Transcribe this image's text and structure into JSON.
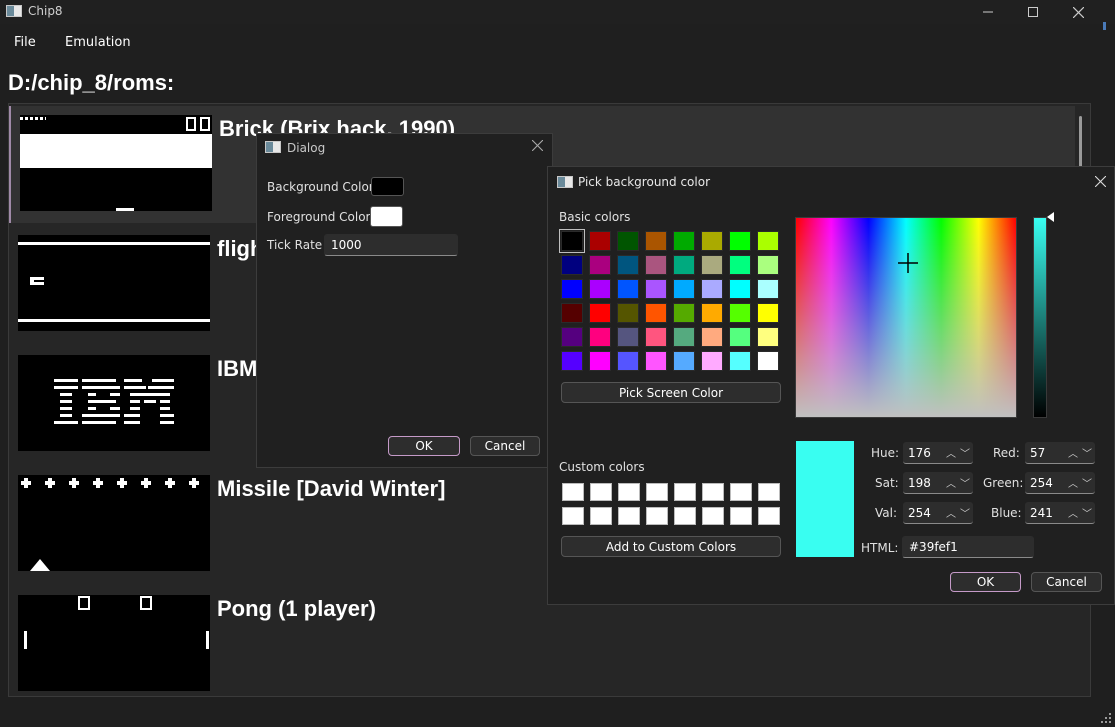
{
  "window": {
    "title": "Chip8"
  },
  "menu": {
    "items": [
      "File",
      "Emulation"
    ]
  },
  "path": "D:/chip_8/roms:",
  "roms": [
    {
      "title": "Brick (Brix hack, 1990)",
      "selected": true
    },
    {
      "title": "flight"
    },
    {
      "title": "IBM"
    },
    {
      "title": "Missile [David Winter]"
    },
    {
      "title": "Pong (1 player)"
    }
  ],
  "settings_dialog": {
    "title": "Dialog",
    "bg_label": "Background Color",
    "bg_color": "#000000",
    "fg_label": "Foreground Color",
    "fg_color": "#ffffff",
    "tick_label": "Tick Rate",
    "tick_value": "1000",
    "ok": "OK",
    "cancel": "Cancel"
  },
  "color_dialog": {
    "title": "Pick background color",
    "basic_label": "Basic colors",
    "basic_colors": [
      "#000000",
      "#aa0000",
      "#005500",
      "#aa5500",
      "#00aa00",
      "#aaaa00",
      "#00ff00",
      "#aaff00",
      "#00007f",
      "#aa007f",
      "#00557f",
      "#aa557f",
      "#00aa7f",
      "#aaaa7f",
      "#00ff7f",
      "#aaff7f",
      "#0000ff",
      "#aa00ff",
      "#0055ff",
      "#aa55ff",
      "#00aaff",
      "#aaaaff",
      "#00ffff",
      "#aaffff",
      "#550000",
      "#ff0000",
      "#555500",
      "#ff5500",
      "#55aa00",
      "#ffaa00",
      "#55ff00",
      "#ffff00",
      "#55007f",
      "#ff007f",
      "#55557f",
      "#ff557f",
      "#55aa7f",
      "#ffaa7f",
      "#55ff7f",
      "#ffff7f",
      "#5500ff",
      "#ff00ff",
      "#5555ff",
      "#ff55ff",
      "#55aaff",
      "#ffaaff",
      "#55ffff",
      "#ffffff"
    ],
    "pick_screen": "Pick Screen Color",
    "custom_label": "Custom colors",
    "custom_colors": [
      "#ffffff",
      "#ffffff",
      "#ffffff",
      "#ffffff",
      "#ffffff",
      "#ffffff",
      "#ffffff",
      "#ffffff",
      "#ffffff",
      "#ffffff",
      "#ffffff",
      "#ffffff",
      "#ffffff",
      "#ffffff",
      "#ffffff",
      "#ffffff"
    ],
    "add_custom": "Add to Custom Colors",
    "current_color": "#39fef1",
    "hue_label": "Hue:",
    "hue": "176",
    "sat_label": "Sat:",
    "sat": "198",
    "val_label": "Val:",
    "val": "254",
    "red_label": "Red:",
    "red": "57",
    "green_label": "Green:",
    "green": "254",
    "blue_label": "Blue:",
    "blue": "241",
    "html_label": "HTML:",
    "html": "#39fef1",
    "ok": "OK",
    "cancel": "Cancel"
  },
  "icons": [
    "app-icon",
    "minimize-icon",
    "maximize-icon",
    "close-icon",
    "crosshair-icon",
    "spin-up-icon",
    "spin-down-icon",
    "resize-grip-icon"
  ]
}
